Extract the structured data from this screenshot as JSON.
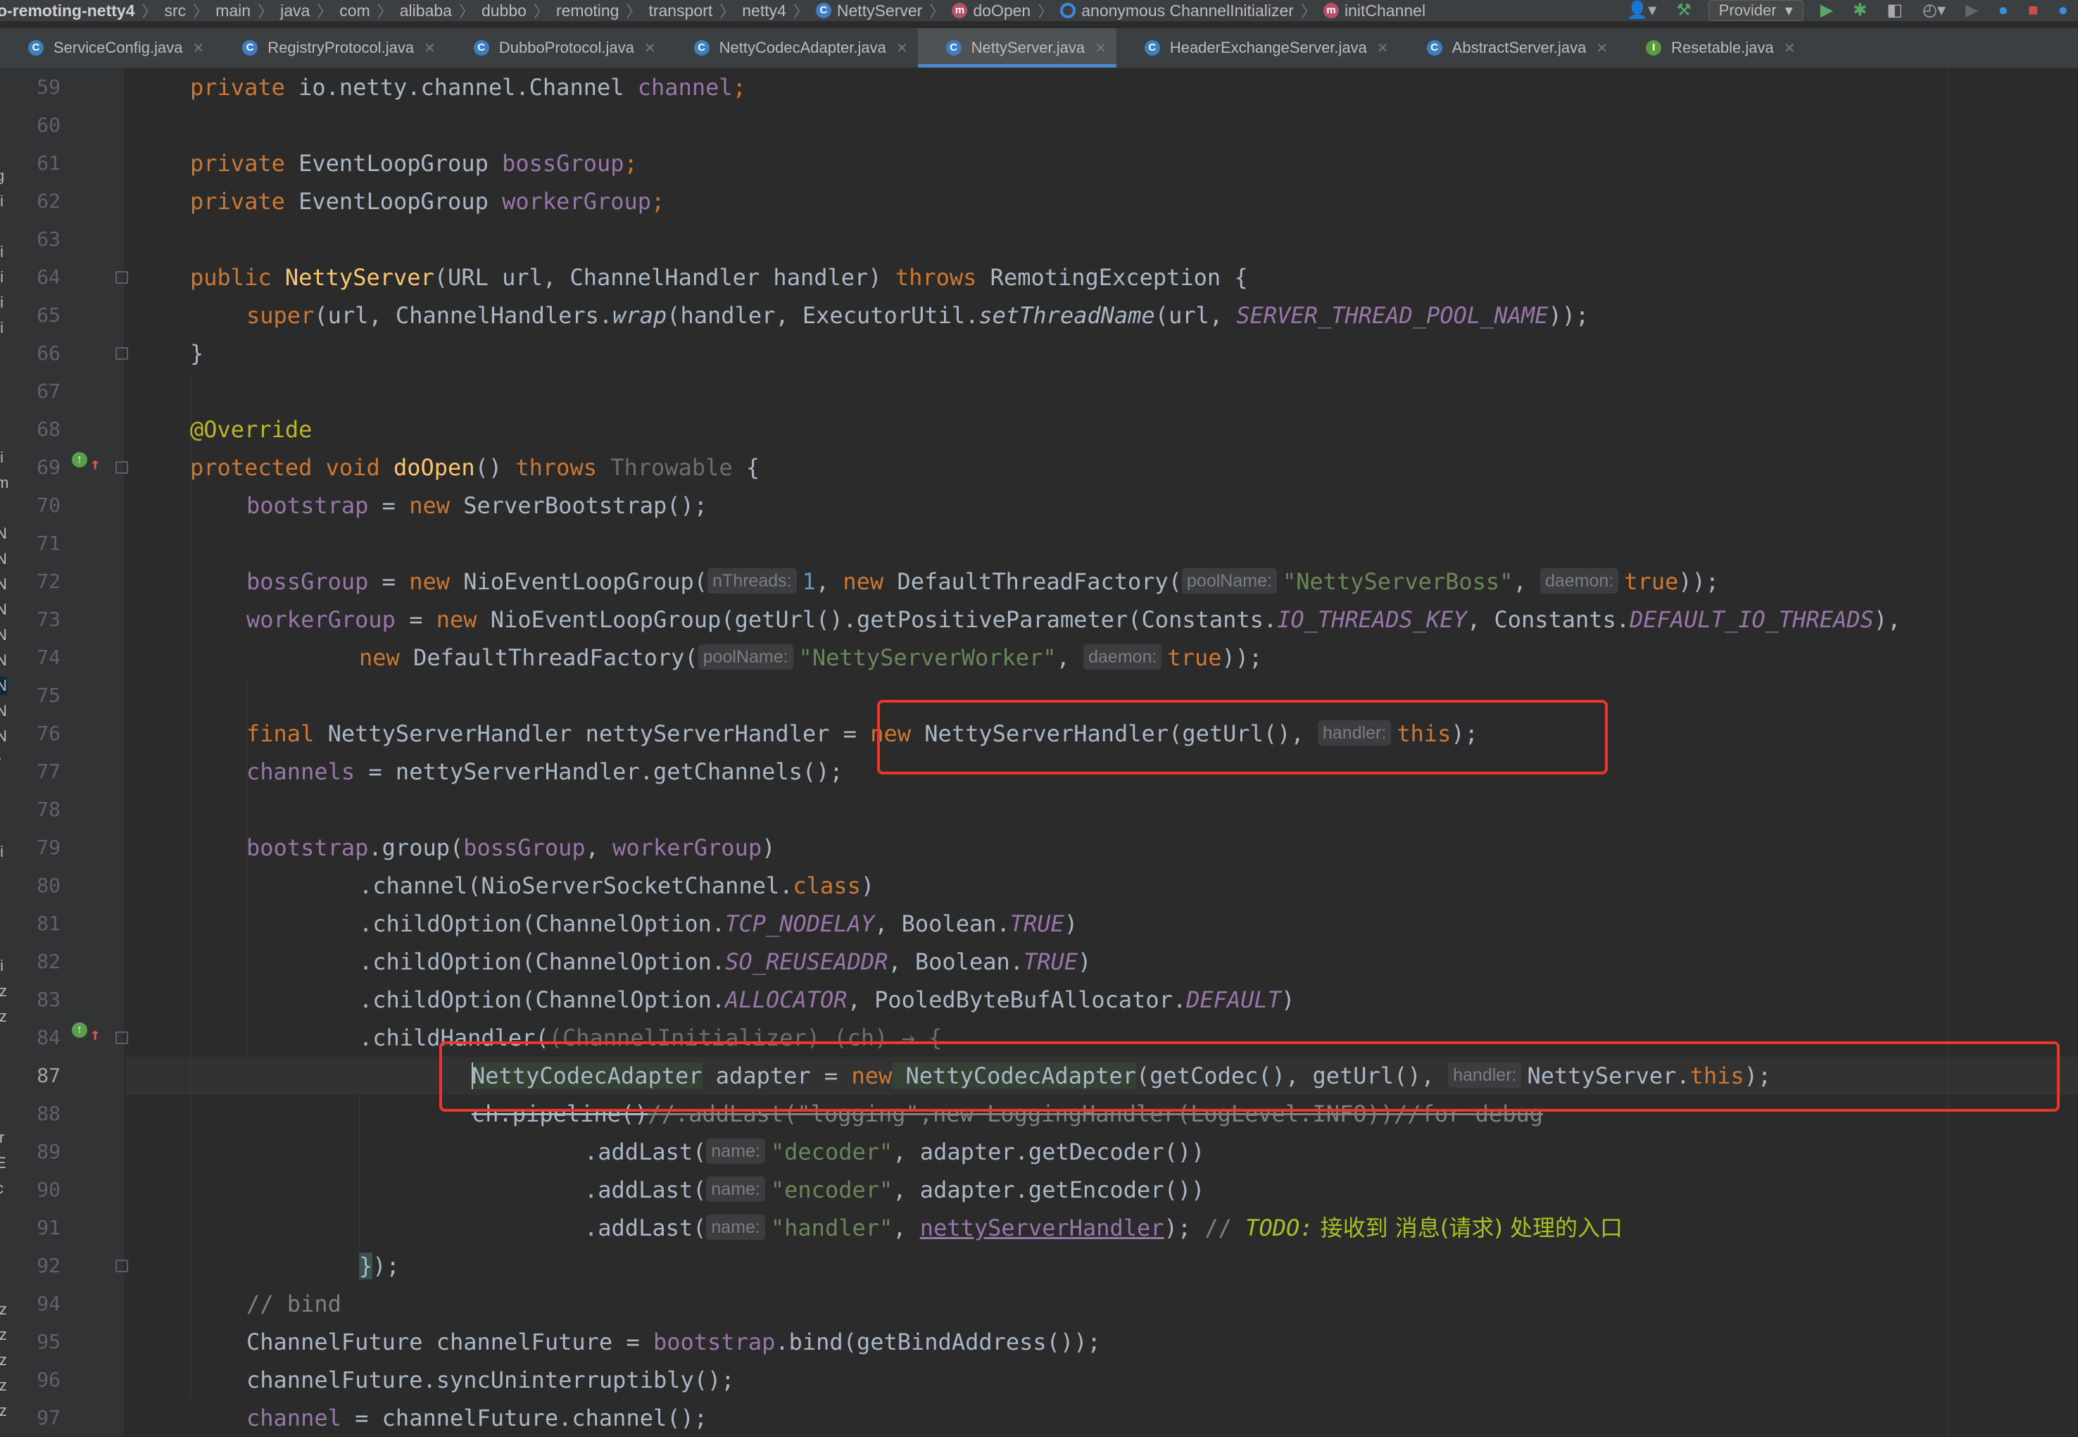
{
  "breadcrumb": {
    "module": "o-remoting-netty4",
    "path": [
      "src",
      "main",
      "java",
      "com",
      "alibaba",
      "dubbo",
      "remoting",
      "transport",
      "netty4"
    ],
    "class_item": "NettyServer",
    "method_item": "doOpen",
    "anon_item": "anonymous ChannelInitializer",
    "init_item": "initChannel"
  },
  "toolbar": {
    "run_config": "Provider",
    "icons": [
      "user-icon",
      "hammer-icon",
      "run-icon",
      "debug-icon",
      "coverage-icon",
      "profile-icon",
      "stop-icon",
      "search-icon"
    ]
  },
  "tabs": [
    {
      "label": "ServiceConfig.java",
      "kind": "C"
    },
    {
      "label": "RegistryProtocol.java",
      "kind": "C"
    },
    {
      "label": "DubboProtocol.java",
      "kind": "C"
    },
    {
      "label": "NettyCodecAdapter.java",
      "kind": "C"
    },
    {
      "label": "NettyServer.java",
      "kind": "C",
      "active": true
    },
    {
      "label": "HeaderExchangeServer.java",
      "kind": "C"
    },
    {
      "label": "AbstractServer.java",
      "kind": "C"
    },
    {
      "label": "Resetable.java",
      "kind": "I"
    }
  ],
  "side_strip": [
    "g",
    "ti",
    "i",
    "ti",
    "ti",
    "ti",
    "ti",
    "i",
    "ti",
    "m",
    "l",
    "N",
    "N",
    "N",
    "N",
    "N",
    "N",
    "N",
    "N",
    "N",
    "r",
    "ti",
    "i",
    "ti",
    "iz",
    "iz",
    "ir",
    "E",
    "c",
    "iz",
    "iz",
    "iz",
    "iz",
    "iz"
  ],
  "editor": {
    "file": "NettyServer.java",
    "current_line": 87,
    "line_numbers": [
      "59",
      "60",
      "61",
      "62",
      "63",
      "64",
      "65",
      "66",
      "67",
      "68",
      "69",
      "70",
      "71",
      "72",
      "73",
      "74",
      "75",
      "76",
      "77",
      "78",
      "79",
      "80",
      "81",
      "82",
      "83",
      "84",
      "87",
      "88",
      "89",
      "90",
      "91",
      "92",
      "94",
      "95",
      "96",
      "97"
    ],
    "inlay_hints": {
      "nThreads": "nThreads:",
      "poolName": "poolName:",
      "daemon": "daemon:",
      "handler": "handler:",
      "name": "name:"
    },
    "code": {
      "l59": [
        "private",
        "io.netty.channel.Channel",
        "channel",
        ";"
      ],
      "l61": [
        "private",
        "EventLoopGroup",
        "bossGroup",
        ";"
      ],
      "l62": [
        "private",
        "EventLoopGroup",
        "workerGroup",
        ";"
      ],
      "l64": [
        "public",
        "NettyServer",
        "(URL url, ChannelHandler handler)",
        "throws",
        "RemotingException {"
      ],
      "l65": [
        "super",
        "(url, ChannelHandlers.",
        "wrap",
        "(handler, ExecutorUtil.",
        "setThreadName",
        "(url, ",
        "SERVER_THREAD_POOL_NAME",
        "));"
      ],
      "l66": "}",
      "l68": "@Override",
      "l69": [
        "protected",
        "void",
        "doOpen",
        "()",
        "throws",
        "Throwable",
        " {"
      ],
      "l70": [
        "bootstrap",
        " = ",
        "new",
        " ServerBootstrap();"
      ],
      "l72": [
        "bossGroup",
        " = ",
        "new",
        " NioEventLoopGroup(",
        "1",
        ", ",
        "new",
        " DefaultThreadFactory(",
        "\"NettyServerBoss\"",
        ", ",
        "true",
        "));"
      ],
      "l73": [
        "workerGroup",
        " = ",
        "new",
        " NioEventLoopGroup(getUrl().getPositiveParameter(Constants.",
        "IO_THREADS_KEY",
        ", Constants.",
        "DEFAULT_IO_THREADS",
        "),"
      ],
      "l74": [
        "new",
        " DefaultThreadFactory(",
        "\"NettyServerWorker\"",
        ", ",
        "true",
        "));"
      ],
      "l76": [
        "final",
        " NettyServerHandler nettyServerHandler = ",
        "new",
        " NettyServerHandler(getUrl(), ",
        "this",
        ");"
      ],
      "l77": [
        "channels",
        " = nettyServerHandler.getChannels();"
      ],
      "l79": [
        "bootstrap",
        ".group(",
        "bossGroup",
        ", ",
        "workerGroup",
        ")"
      ],
      "l80": [
        ".channel(NioServerSocketChannel.",
        "class",
        ")"
      ],
      "l81": [
        ".childOption(ChannelOption.",
        "TCP_NODELAY",
        ", Boolean.",
        "TRUE",
        ")"
      ],
      "l82": [
        ".childOption(ChannelOption.",
        "SO_REUSEADDR",
        ", Boolean.",
        "TRUE",
        ")"
      ],
      "l83": [
        ".childOption(ChannelOption.",
        "ALLOCATOR",
        ", PooledByteBufAllocator.",
        "DEFAULT",
        ")"
      ],
      "l84": [
        ".childHandler(",
        "(ChannelInitializer) (ch) → {"
      ],
      "l87": [
        "NettyCodecAdapter",
        " adapter = ",
        "new",
        " NettyCodecAdapter",
        "(getCodec(), getUrl(), ",
        "NettyServer.",
        "this",
        ");"
      ],
      "l88": [
        "ch.pipeline()",
        "//.addLast(\"logging\",new LoggingHandler(LogLevel.INFO))//for debug"
      ],
      "l89": [
        ".addLast(",
        "\"decoder\"",
        ", adapter.getDecoder())"
      ],
      "l90": [
        ".addLast(",
        "\"encoder\"",
        ", adapter.getEncoder())"
      ],
      "l91": [
        ".addLast(",
        "\"handler\"",
        ", ",
        "nettyServerHandler",
        ");",
        " // ",
        "TODO:",
        " 接收到 消息(请求) 处理的入口"
      ],
      "l92": [
        "}",
        ");"
      ],
      "l94": "// bind",
      "l95": [
        "ChannelFuture channelFuture = ",
        "bootstrap",
        ".bind(getBindAddress());"
      ],
      "l96": "channelFuture.syncUninterruptibly();",
      "l97": [
        "channel",
        " = channelFuture.channel();"
      ]
    }
  },
  "colors": {
    "keyword": "#cc7832",
    "method_decl": "#ffc66d",
    "field": "#9876aa",
    "string": "#6a8759",
    "number": "#6897bb",
    "annotation": "#bbb529",
    "comment": "#808080",
    "todo": "#a8c023",
    "highlight_box": "#e8382e",
    "editor_bg": "#2b2b2b"
  }
}
